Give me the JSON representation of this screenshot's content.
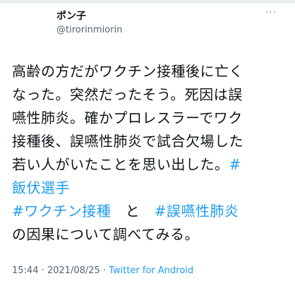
{
  "tweet": {
    "display_name": "ポン子",
    "handle": "@tirorinmiorin",
    "more": "···",
    "line1": "高齢の方だがワクチン接種後に亡く",
    "line2": "なった。突然だったそう。死因は誤",
    "line3": "嚥性肺炎。確かプロレスラーでワク",
    "line4": "接種後、誤嚥性肺炎で試合欠場した",
    "line5_text": "若い人がいたことを思い出した。",
    "line5_hashtag": "#",
    "line6_hashtag": "飯伏選手",
    "line7_hashtag1": "#ワクチン接種",
    "line7_and": "　と　",
    "line7_hashtag2": "#誤嚥性肺炎",
    "line8": "の因果について調べてみる。",
    "timestamp": "15:44 · 2021/08/25 · ",
    "source": "Twitter for Android"
  },
  "colors": {
    "link": "#1d9bf0",
    "text": "#0f1419",
    "secondary": "#536471"
  }
}
